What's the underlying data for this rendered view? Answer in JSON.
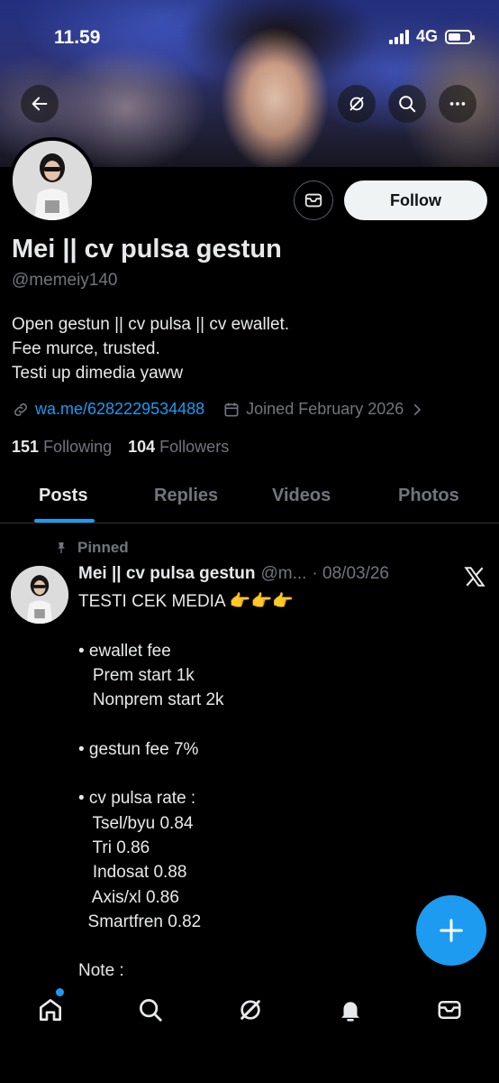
{
  "status_bar": {
    "time": "11.59",
    "network": "4G"
  },
  "profile": {
    "name": "Mei || cv pulsa gestun",
    "handle": "@memeiy140",
    "bio": [
      "Open gestun || cv pulsa || cv ewallet.",
      "Fee murce, trusted.",
      "Testi up dimedia yaww"
    ],
    "link": "wa.me/6282229534488",
    "joined": "Joined February 2026",
    "following_count": "151",
    "following_label": "Following",
    "followers_count": "104",
    "followers_label": "Followers",
    "follow_label": "Follow"
  },
  "tabs": [
    {
      "label": "Posts"
    },
    {
      "label": "Replies"
    },
    {
      "label": "Videos"
    },
    {
      "label": "Photos"
    }
  ],
  "post": {
    "pinned_label": "Pinned",
    "author_name": "Mei || cv pulsa gestun",
    "author_handle": "@m...",
    "date": "· 08/03/26",
    "lines": [
      "TESTI CEK MEDIA 👉👉👉",
      "",
      "• ewallet fee",
      "   Prem start 1k",
      "   Nonprem start 2k",
      "",
      "• gestun fee 7%",
      "",
      "• cv pulsa rate :",
      "   Tsel/byu 0.84",
      "   Tri 0.86",
      "   Indosat 0.88",
      "   Axis/xl 0.86",
      "  Smartfren 0.82",
      "",
      "Note :"
    ]
  },
  "icons": {
    "back": "arrow-left-icon",
    "grok": "grok-icon",
    "search": "search-icon",
    "more": "more-icon",
    "message": "message-icon",
    "link": "link-icon",
    "calendar": "calendar-icon",
    "pin": "pin-icon",
    "x": "x-logo-icon",
    "compose": "plus-icon",
    "home": "home-icon",
    "notifications": "bell-icon",
    "mail": "mail-icon"
  },
  "colors": {
    "accent": "#1d9bf0",
    "background": "#000000",
    "muted": "#71767b"
  }
}
